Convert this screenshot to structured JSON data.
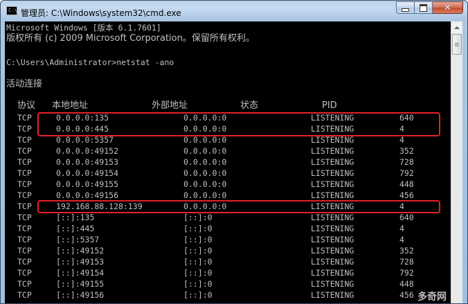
{
  "window": {
    "title": "管理员: C:\\Windows\\system32\\cmd.exe"
  },
  "console": {
    "banner_line1": "Microsoft Windows [版本 6.1.7601]",
    "banner_line2": "版权所有 (c) 2009 Microsoft Corporation。保留所有权利。",
    "prompt_line": "C:\\Users\\Administrator>netstat -ano",
    "section_title": "活动连接",
    "headers": {
      "proto": "协议",
      "local": "本地地址",
      "foreign": "外部地址",
      "state": "状态",
      "pid": "PID"
    },
    "rows": [
      {
        "proto": "TCP",
        "local": "0.0.0.0:135",
        "foreign": "0.0.0.0:0",
        "state": "LISTENING",
        "pid": "640"
      },
      {
        "proto": "TCP",
        "local": "0.0.0.0:445",
        "foreign": "0.0.0.0:0",
        "state": "LISTENING",
        "pid": "4"
      },
      {
        "proto": "TCP",
        "local": "0.0.0.0:5357",
        "foreign": "0.0.0.0:0",
        "state": "LISTENING",
        "pid": "4"
      },
      {
        "proto": "TCP",
        "local": "0.0.0.0:49152",
        "foreign": "0.0.0.0:0",
        "state": "LISTENING",
        "pid": "352"
      },
      {
        "proto": "TCP",
        "local": "0.0.0.0:49153",
        "foreign": "0.0.0.0:0",
        "state": "LISTENING",
        "pid": "728"
      },
      {
        "proto": "TCP",
        "local": "0.0.0.0:49154",
        "foreign": "0.0.0.0:0",
        "state": "LISTENING",
        "pid": "792"
      },
      {
        "proto": "TCP",
        "local": "0.0.0.0:49155",
        "foreign": "0.0.0.0:0",
        "state": "LISTENING",
        "pid": "448"
      },
      {
        "proto": "TCP",
        "local": "0.0.0.0:49156",
        "foreign": "0.0.0.0:0",
        "state": "LISTENING",
        "pid": "456"
      },
      {
        "proto": "TCP",
        "local": "192.168.88.128:139",
        "foreign": "0.0.0.0:0",
        "state": "LISTENING",
        "pid": "4"
      },
      {
        "proto": "TCP",
        "local": "[::]:135",
        "foreign": "[::]:0",
        "state": "LISTENING",
        "pid": "640"
      },
      {
        "proto": "TCP",
        "local": "[::]:445",
        "foreign": "[::]:0",
        "state": "LISTENING",
        "pid": "4"
      },
      {
        "proto": "TCP",
        "local": "[::]:5357",
        "foreign": "[::]:0",
        "state": "LISTENING",
        "pid": "4"
      },
      {
        "proto": "TCP",
        "local": "[::]:49152",
        "foreign": "[::]:0",
        "state": "LISTENING",
        "pid": "352"
      },
      {
        "proto": "TCP",
        "local": "[::]:49153",
        "foreign": "[::]:0",
        "state": "LISTENING",
        "pid": "728"
      },
      {
        "proto": "TCP",
        "local": "[::]:49154",
        "foreign": "[::]:0",
        "state": "LISTENING",
        "pid": "792"
      },
      {
        "proto": "TCP",
        "local": "[::]:49155",
        "foreign": "[::]:0",
        "state": "LISTENING",
        "pid": "448"
      },
      {
        "proto": "TCP",
        "local": "[::]:49156",
        "foreign": "[::]:0",
        "state": "LISTENING",
        "pid": "456"
      }
    ],
    "highlight_color": "#e8202a"
  },
  "watermark": "多奇网"
}
